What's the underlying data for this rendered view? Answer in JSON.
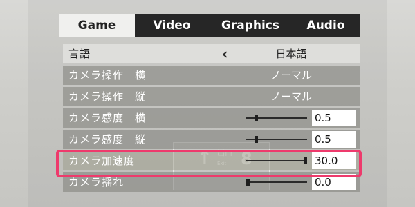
{
  "tabs": [
    {
      "label": "Game",
      "active": true
    },
    {
      "label": "Video",
      "active": false
    },
    {
      "label": "Graphics",
      "active": false
    },
    {
      "label": "Audio",
      "active": false
    }
  ],
  "settings": [
    {
      "label": "言語",
      "value": "日本語",
      "type": "selector"
    },
    {
      "label": "カメラ操作　横",
      "value": "ノーマル",
      "type": "text"
    },
    {
      "label": "カメラ操作　縦",
      "value": "ノーマル",
      "type": "text"
    },
    {
      "label": "カメラ感度　横",
      "value": "0.5",
      "type": "slider",
      "fraction": 0.15
    },
    {
      "label": "カメラ感度　縦",
      "value": "0.5",
      "type": "slider",
      "fraction": 0.15
    },
    {
      "label": "カメラ加速度",
      "value": "30.0",
      "type": "slider",
      "fraction": 1.0,
      "highlighted": true
    },
    {
      "label": "カメラ揺れ",
      "value": "0.0",
      "type": "slider",
      "fraction": 0.0
    }
  ],
  "background_sign": {
    "main": "出口",
    "sub": "Exit",
    "number": "8"
  },
  "colors": {
    "highlight_border": "#ee3a6c",
    "tab_bar": "#262626",
    "active_tab": "#f0f0ee"
  },
  "icons": {
    "language_prev": "chevron-left-icon",
    "sign_arrow": "arrow-up-icon"
  }
}
